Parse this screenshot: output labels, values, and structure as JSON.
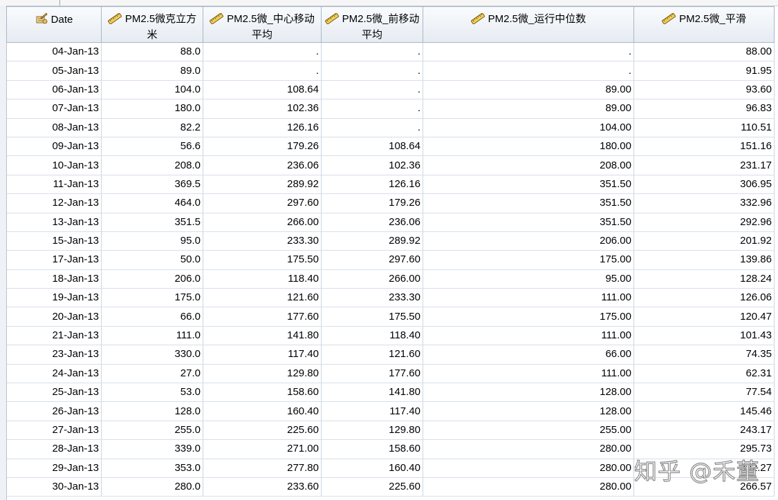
{
  "columns": [
    {
      "key": "date",
      "label": "Date",
      "icon": "date-variable-icon"
    },
    {
      "key": "pm",
      "label": "PM2.5微克立方米",
      "icon": "scale-variable-icon"
    },
    {
      "key": "cma",
      "label": "PM2.5微_中心移动平均",
      "icon": "scale-variable-icon"
    },
    {
      "key": "pma",
      "label": "PM2.5微_前移动平均",
      "icon": "scale-variable-icon"
    },
    {
      "key": "med",
      "label": "PM2.5微_运行中位数",
      "icon": "scale-variable-icon"
    },
    {
      "key": "smooth",
      "label": "PM2.5微_平滑",
      "icon": "scale-variable-icon"
    }
  ],
  "rows": [
    [
      "04-Jan-13",
      "88.0",
      ".",
      ".",
      ".",
      "88.00"
    ],
    [
      "05-Jan-13",
      "89.0",
      ".",
      ".",
      ".",
      "91.95"
    ],
    [
      "06-Jan-13",
      "104.0",
      "108.64",
      ".",
      "89.00",
      "93.60"
    ],
    [
      "07-Jan-13",
      "180.0",
      "102.36",
      ".",
      "89.00",
      "96.83"
    ],
    [
      "08-Jan-13",
      "82.2",
      "126.16",
      ".",
      "104.00",
      "110.51"
    ],
    [
      "09-Jan-13",
      "56.6",
      "179.26",
      "108.64",
      "180.00",
      "151.16"
    ],
    [
      "10-Jan-13",
      "208.0",
      "236.06",
      "102.36",
      "208.00",
      "231.17"
    ],
    [
      "11-Jan-13",
      "369.5",
      "289.92",
      "126.16",
      "351.50",
      "306.95"
    ],
    [
      "12-Jan-13",
      "464.0",
      "297.60",
      "179.26",
      "351.50",
      "332.96"
    ],
    [
      "13-Jan-13",
      "351.5",
      "266.00",
      "236.06",
      "351.50",
      "292.96"
    ],
    [
      "15-Jan-13",
      "95.0",
      "233.30",
      "289.92",
      "206.00",
      "201.92"
    ],
    [
      "17-Jan-13",
      "50.0",
      "175.50",
      "297.60",
      "175.00",
      "139.86"
    ],
    [
      "18-Jan-13",
      "206.0",
      "118.40",
      "266.00",
      "95.00",
      "128.24"
    ],
    [
      "19-Jan-13",
      "175.0",
      "121.60",
      "233.30",
      "111.00",
      "126.06"
    ],
    [
      "20-Jan-13",
      "66.0",
      "177.60",
      "175.50",
      "175.00",
      "120.47"
    ],
    [
      "21-Jan-13",
      "111.0",
      "141.80",
      "118.40",
      "111.00",
      "101.43"
    ],
    [
      "23-Jan-13",
      "330.0",
      "117.40",
      "121.60",
      "66.00",
      "74.35"
    ],
    [
      "24-Jan-13",
      "27.0",
      "129.80",
      "177.60",
      "111.00",
      "62.31"
    ],
    [
      "25-Jan-13",
      "53.0",
      "158.60",
      "141.80",
      "128.00",
      "77.54"
    ],
    [
      "26-Jan-13",
      "128.0",
      "160.40",
      "117.40",
      "128.00",
      "145.46"
    ],
    [
      "27-Jan-13",
      "255.0",
      "225.60",
      "129.80",
      "255.00",
      "243.17"
    ],
    [
      "28-Jan-13",
      "339.0",
      "271.00",
      "158.60",
      "280.00",
      "295.73"
    ],
    [
      "29-Jan-13",
      "353.0",
      "277.80",
      "160.40",
      "280.00",
      "302.27"
    ],
    [
      "30-Jan-13",
      "280.0",
      "233.60",
      "225.60",
      "280.00",
      "266.57"
    ]
  ],
  "watermark": "知乎 @禾董",
  "colors": {
    "header_bg": "#e6ebf2",
    "grid_line": "#c9d6e3",
    "border": "#a9b6c8"
  }
}
